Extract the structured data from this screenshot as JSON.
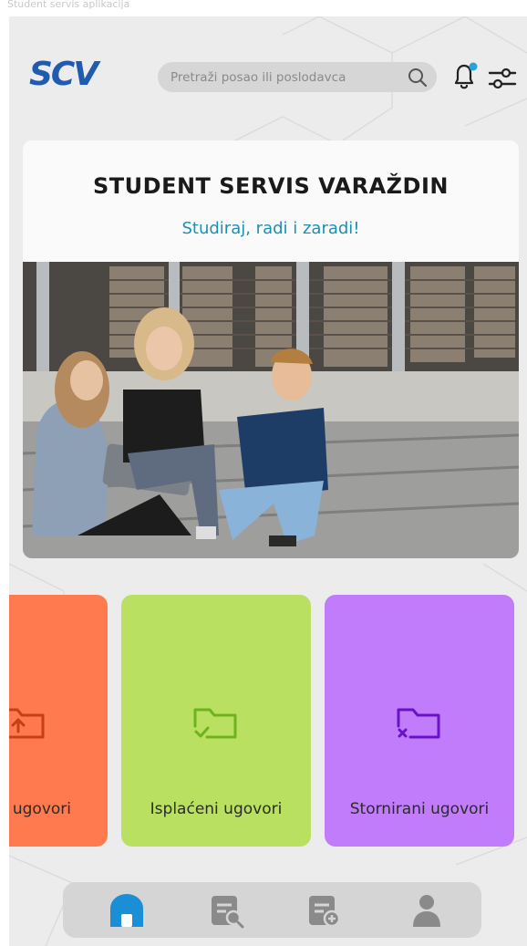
{
  "status_caption": "Student servis aplikacija",
  "header": {
    "logo_text": "SCV",
    "search_placeholder": "Pretraži posao ili poslodavca",
    "icons": [
      "search-icon",
      "bell-icon",
      "filter-icon"
    ],
    "notification_dot_color": "#27a3d8"
  },
  "hero": {
    "title": "STUDENT SERVIS VARAŽDIN",
    "subtitle": "Studiraj, radi i zaradi!"
  },
  "cards": [
    {
      "label": "ugovori",
      "icon": "folder-upload-icon",
      "color": "#ff7a4f",
      "accent": "#c93d17"
    },
    {
      "label": "Isplaćeni ugovori",
      "icon": "folder-check-icon",
      "color": "#b9e061",
      "accent": "#6fb21e"
    },
    {
      "label": "Stornirani ugovori",
      "icon": "folder-x-icon",
      "color": "#c17cfb",
      "accent": "#6a12c9"
    }
  ],
  "bottom_nav": {
    "items": [
      "home-icon",
      "search-documents-icon",
      "add-document-icon",
      "profile-icon"
    ],
    "active_color": "#1b8fd6",
    "inactive_color": "#8a8a8a"
  }
}
